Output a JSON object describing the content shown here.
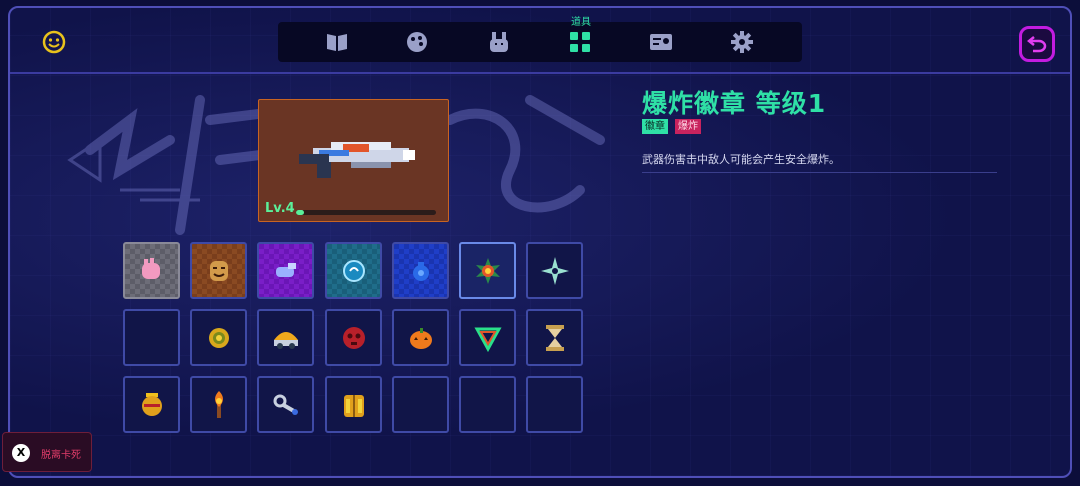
{
  "header": {
    "active_tab_label": "道具",
    "tabs": [
      {
        "icon": "book-icon",
        "active": false
      },
      {
        "icon": "palette-icon",
        "active": false
      },
      {
        "icon": "pet-icon",
        "active": false
      },
      {
        "icon": "grid-icon",
        "active": true
      },
      {
        "icon": "profile-card-icon",
        "active": false
      },
      {
        "icon": "gear-icon",
        "active": false
      }
    ],
    "left_icon": "smiley-icon",
    "back_icon": "back-arrow-icon"
  },
  "weapon": {
    "level_text": "Lv.4",
    "level_progress": 0.06
  },
  "item_slots": [
    {
      "icon": "gloves-icon",
      "rarity": "gray"
    },
    {
      "icon": "mask-icon",
      "rarity": "orange"
    },
    {
      "icon": "whistle-icon",
      "rarity": "purple"
    },
    {
      "icon": "orb-icon",
      "rarity": "teal"
    },
    {
      "icon": "pouch-icon",
      "rarity": "blue"
    },
    {
      "icon": "explosion-badge-icon",
      "rarity": "selected"
    },
    {
      "icon": "shuriken-icon",
      "rarity": "none"
    },
    {
      "icon": "",
      "rarity": "none"
    },
    {
      "icon": "sun-amulet-icon",
      "rarity": "none"
    },
    {
      "icon": "helmet-icon",
      "rarity": "none"
    },
    {
      "icon": "red-skull-icon",
      "rarity": "none"
    },
    {
      "icon": "pumpkin-icon",
      "rarity": "none"
    },
    {
      "icon": "triangle-badge-icon",
      "rarity": "none"
    },
    {
      "icon": "hourglass-icon",
      "rarity": "none"
    },
    {
      "icon": "golden-urn-icon",
      "rarity": "none"
    },
    {
      "icon": "torch-icon",
      "rarity": "none"
    },
    {
      "icon": "key-ring-icon",
      "rarity": "none"
    },
    {
      "icon": "gold-armor-icon",
      "rarity": "none"
    },
    {
      "icon": "",
      "rarity": "none"
    },
    {
      "icon": "",
      "rarity": "none"
    },
    {
      "icon": "",
      "rarity": "none"
    }
  ],
  "info": {
    "title": "爆炸徽章 等级1",
    "tags": [
      "徽章",
      "爆炸"
    ],
    "description": "武器伤害击中敌人可能会产生安全爆炸。"
  },
  "unstuck": {
    "x_label": "X",
    "label": "脱离卡死"
  },
  "colors": {
    "accent": "#2fe0a6",
    "back_button": "#c21ce0",
    "tag_red": "#c8235e",
    "weapon_card": "#6a3524"
  }
}
